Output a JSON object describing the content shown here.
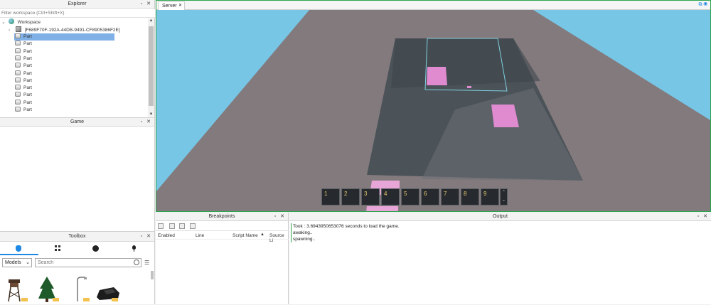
{
  "explorer": {
    "title": "Explorer",
    "filter_placeholder": "Filter workspace (Ctrl+Shift+X)",
    "workspace_label": "Workspace",
    "model_label": "[F689F70F-192A-44DB-9491-CF8905386F2E]",
    "parts": [
      "Part",
      "Part",
      "Part",
      "Part",
      "Part",
      "Part",
      "Part",
      "Part",
      "Part",
      "Part",
      "Part"
    ],
    "selected_index": 0
  },
  "game_panel": {
    "title": "Game"
  },
  "toolbox": {
    "title": "Toolbox",
    "category_value": "Models",
    "search_placeholder": "Search",
    "tab_icons": [
      "marketplace-icon",
      "inventory-icon",
      "recent-icon",
      "creations-icon"
    ]
  },
  "viewport": {
    "tab_label": "Server",
    "hotbar_slots": [
      "1",
      "2",
      "3",
      "4",
      "5",
      "6",
      "7",
      "8",
      "9"
    ]
  },
  "breakpoints": {
    "title": "Breakpoints",
    "columns": [
      "Enabled",
      "Line",
      "Script Name",
      "Source Li"
    ]
  },
  "output": {
    "title": "Output",
    "lines": [
      "Took : 3.6943950653076  seconds to load the game.",
      "awaking..",
      "spawning.."
    ]
  },
  "colors": {
    "accent": "#2ea44f",
    "selection": "#7fb0e6",
    "sky": "#77c6e6",
    "baseplate": "#837a7d"
  }
}
